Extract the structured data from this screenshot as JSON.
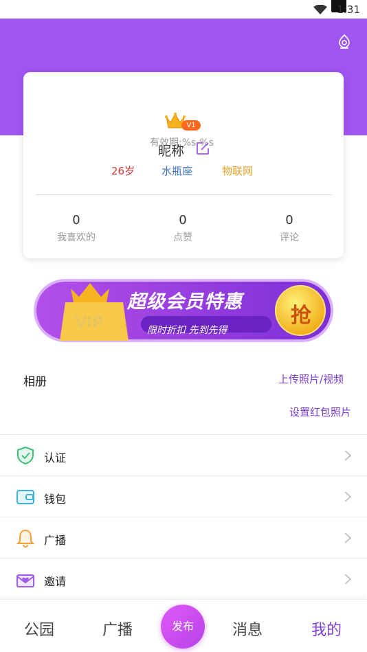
{
  "status": {
    "time": "1:31"
  },
  "profile": {
    "level_badge": "V1",
    "validity": "有效期:%s-%s",
    "nickname": "昵称",
    "tags": {
      "age": "26岁",
      "zodiac": "水瓶座",
      "industry": "物联网"
    },
    "stats": [
      {
        "value": "0",
        "label": "我喜欢的"
      },
      {
        "value": "0",
        "label": "点赞"
      },
      {
        "value": "0",
        "label": "评论"
      }
    ]
  },
  "vip_banner": {
    "title": "超级会员特惠",
    "subtitle": "限时折扣  先到先得",
    "badge_text": "VIP",
    "grab_label": "抢"
  },
  "album": {
    "label": "相册",
    "upload_link": "上传照片/视频",
    "red_packet_link": "设置红包照片"
  },
  "menu": [
    {
      "label": "认证",
      "icon": "shield-check-icon"
    },
    {
      "label": "钱包",
      "icon": "wallet-icon"
    },
    {
      "label": "广播",
      "icon": "bell-icon"
    },
    {
      "label": "邀请",
      "icon": "envelope-heart-icon"
    }
  ],
  "tabbar": {
    "park": "公园",
    "broadcast": "广播",
    "publish": "发布",
    "messages": "消息",
    "mine": "我的"
  },
  "colors": {
    "accent": "#9f55f0",
    "link": "#7d3fd6",
    "age": "#d2373c",
    "zodiac": "#3f73c9",
    "industry": "#e3a12b"
  }
}
